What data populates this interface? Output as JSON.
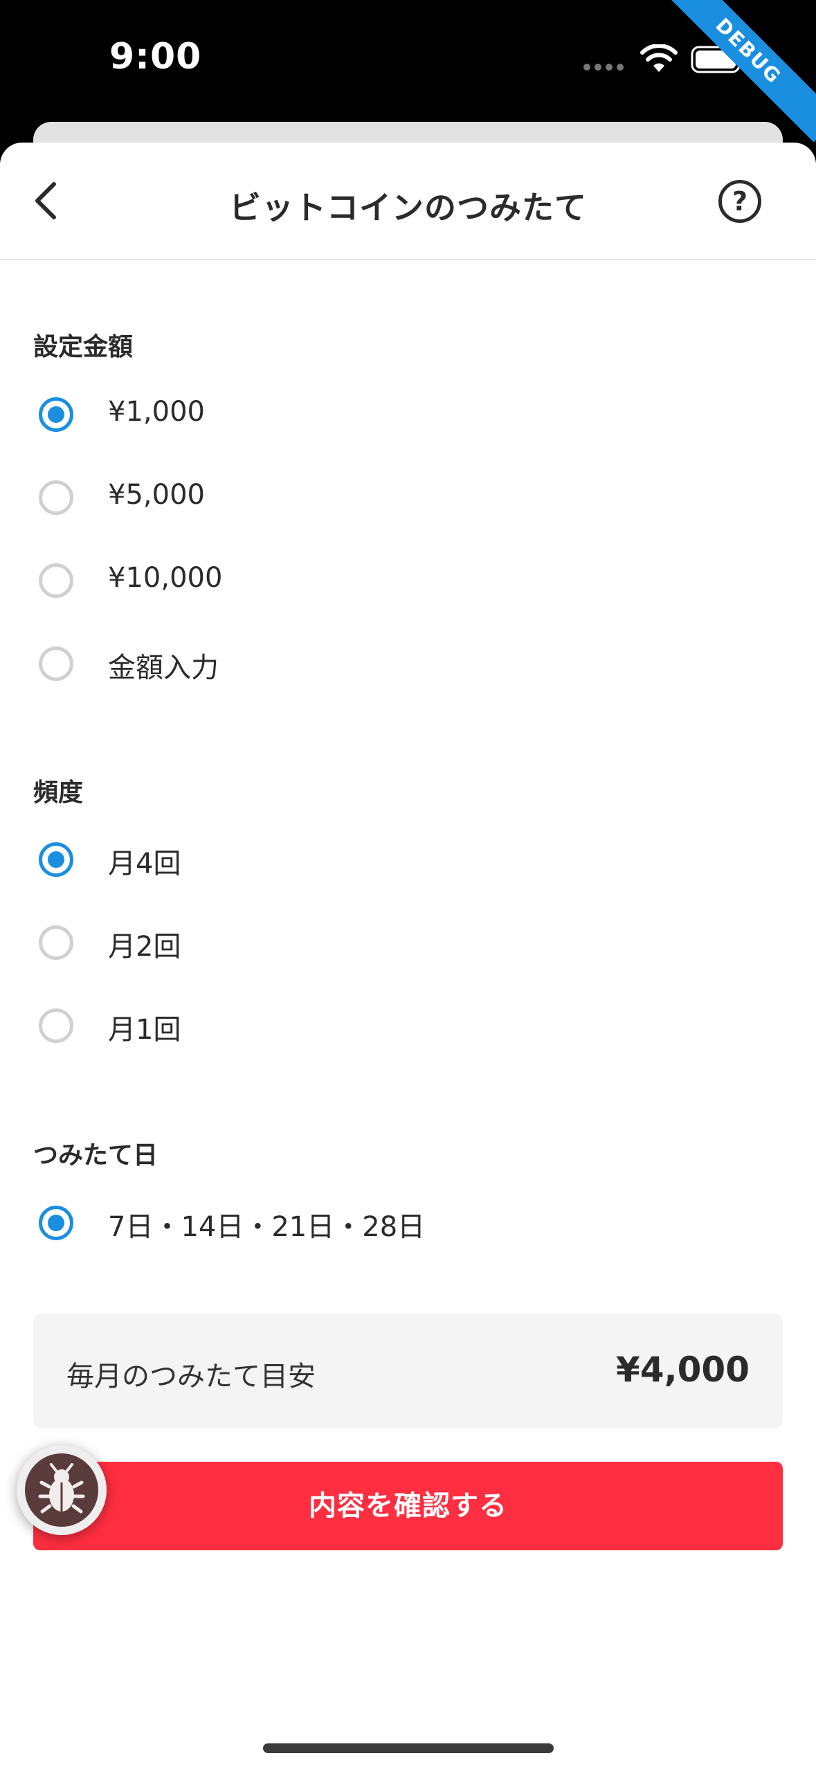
{
  "status_bar": {
    "time": "9:00",
    "debug_label": "DEBUG"
  },
  "header": {
    "title": "ビットコインのつみたて",
    "help_label": "?"
  },
  "amount": {
    "label": "設定金額",
    "options": [
      {
        "label": "¥1,000",
        "selected": true
      },
      {
        "label": "¥5,000",
        "selected": false
      },
      {
        "label": "¥10,000",
        "selected": false
      },
      {
        "label": "金額入力",
        "selected": false
      }
    ]
  },
  "frequency": {
    "label": "頻度",
    "options": [
      {
        "label": "月4回",
        "selected": true
      },
      {
        "label": "月2回",
        "selected": false
      },
      {
        "label": "月1回",
        "selected": false
      }
    ]
  },
  "accumulation_day": {
    "label": "つみたて日",
    "options": [
      {
        "label": "7日・14日・21日・28日",
        "selected": true
      }
    ]
  },
  "estimate": {
    "label": "毎月のつみたて目安",
    "value": "¥4,000"
  },
  "confirm": {
    "label": "内容を確認する"
  },
  "colors": {
    "accent": "#1a8fe0",
    "confirm": "#ff2e40"
  }
}
